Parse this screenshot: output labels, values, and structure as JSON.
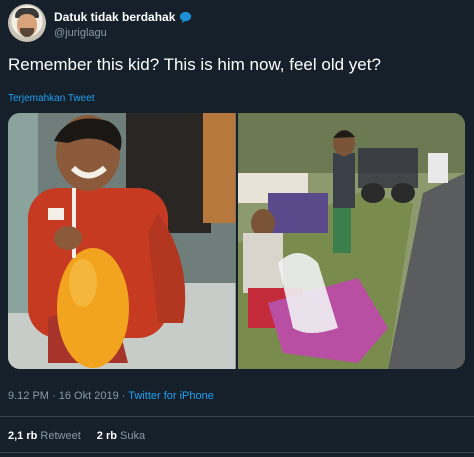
{
  "tweet": {
    "display_name": "Datuk tidak berdahak",
    "handle": "@juriglagu",
    "text": "Remember this kid? This is him now, feel old yet?",
    "translate_label": "Terjemahkan Tweet",
    "time": "9.12 PM",
    "separator": " · ",
    "date": "16 Okt 2019",
    "source": "Twitter for iPhone",
    "retweets_count": "2,1 rb",
    "retweets_label": "Retweet",
    "likes_count": "2 rb",
    "likes_label": "Suka"
  },
  "icons": {
    "verified": "blue-bubble-icon",
    "avatar": "avatar-illustration"
  },
  "colors": {
    "background": "#15202b",
    "link": "#1da1f2",
    "muted": "#8899a6",
    "divider": "#38444d"
  }
}
